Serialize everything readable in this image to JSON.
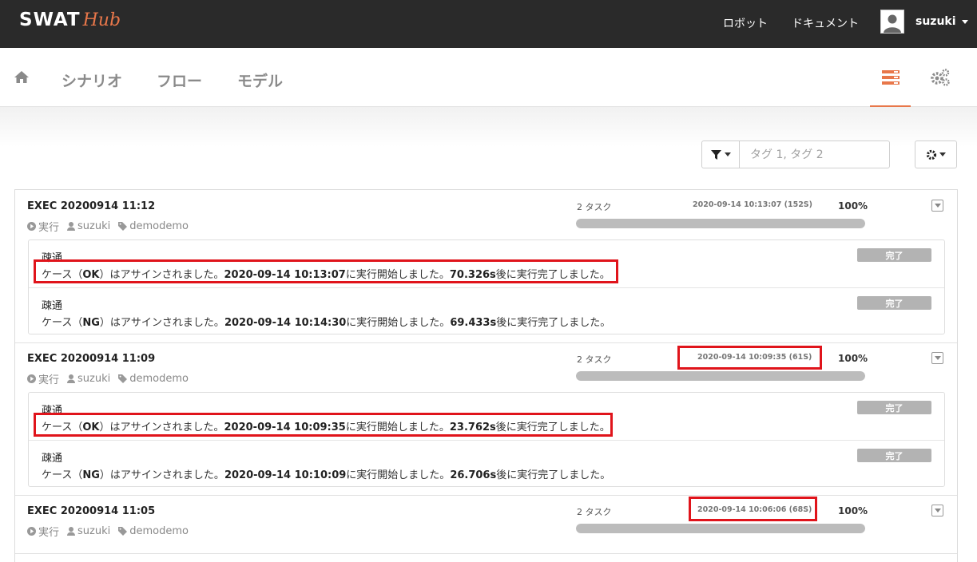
{
  "app": {
    "logo_main": "SWAT",
    "logo_sub": "Hub",
    "top_links": [
      "ロボット",
      "ドキュメント"
    ],
    "user": "suzuki"
  },
  "nav": {
    "items": [
      "シナリオ",
      "フロー",
      "モデル"
    ]
  },
  "filter": {
    "placeholder": "タグ 1, タグ 2"
  },
  "colors": {
    "accent": "#e8774a",
    "topbar": "#2a2a2a",
    "highlight": "#e0141b",
    "badge": "#b3b3b3"
  },
  "executions": [
    {
      "title": "EXEC 20200914 11:12",
      "status": "実行",
      "user": "suzuki",
      "tag": "demodemo",
      "tasks": "2 タスク",
      "started": "2020-09-14 10:13:07 (152S)",
      "progress_label": "100%",
      "progress": 1.0,
      "cases": [
        {
          "name": "疎通",
          "badge": "完了",
          "msg_a": "ケース（",
          "result": "OK",
          "msg_b": "）はアサインされました。",
          "start": "2020-09-14 10:13:07",
          "msg_c": "に実行開始しました。",
          "duration": "70.326s",
          "msg_d": "後に実行完了しました。"
        },
        {
          "name": "疎通",
          "badge": "完了",
          "msg_a": "ケース（",
          "result": "NG",
          "msg_b": "）はアサインされました。",
          "start": "2020-09-14 10:14:30",
          "msg_c": "に実行開始しました。",
          "duration": "69.433s",
          "msg_d": "後に実行完了しました。"
        }
      ]
    },
    {
      "title": "EXEC 20200914 11:09",
      "status": "実行",
      "user": "suzuki",
      "tag": "demodemo",
      "tasks": "2 タスク",
      "started": "2020-09-14 10:09:35 (61S)",
      "progress_label": "100%",
      "progress": 1.0,
      "cases": [
        {
          "name": "疎通",
          "badge": "完了",
          "msg_a": "ケース（",
          "result": "OK",
          "msg_b": "）はアサインされました。",
          "start": "2020-09-14 10:09:35",
          "msg_c": "に実行開始しました。",
          "duration": "23.762s",
          "msg_d": "後に実行完了しました。"
        },
        {
          "name": "疎通",
          "badge": "完了",
          "msg_a": "ケース（",
          "result": "NG",
          "msg_b": "）はアサインされました。",
          "start": "2020-09-14 10:10:09",
          "msg_c": "に実行開始しました。",
          "duration": "26.706s",
          "msg_d": "後に実行完了しました。"
        }
      ]
    },
    {
      "title": "EXEC 20200914 11:05",
      "status": "実行",
      "user": "suzuki",
      "tag": "demodemo",
      "tasks": "2 タスク",
      "started": "2020-09-14 10:06:06 (68S)",
      "progress_label": "100%",
      "progress": 1.0,
      "cases": []
    }
  ]
}
